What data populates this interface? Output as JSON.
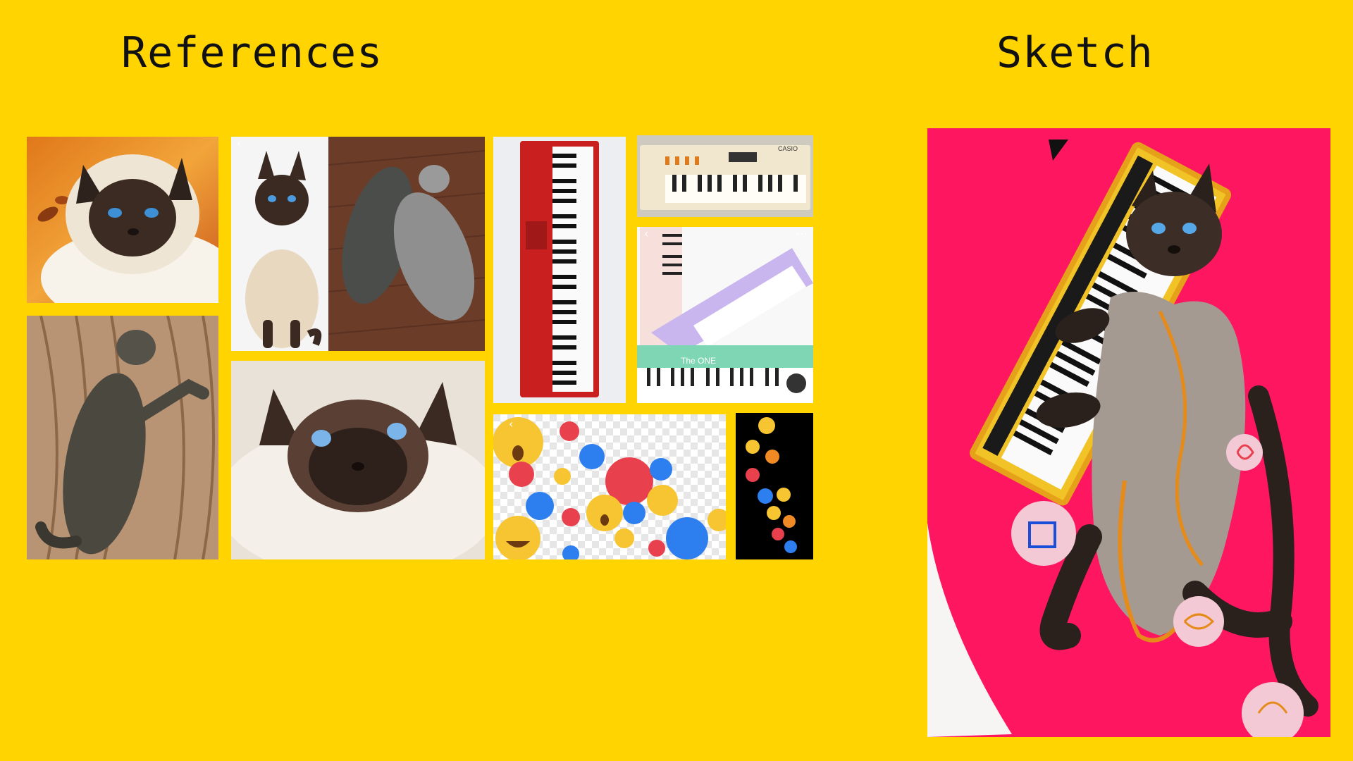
{
  "headings": {
    "references": "References",
    "sketch": "Sketch"
  },
  "colors": {
    "background": "#FFD400",
    "sketch_background": "#FF1660"
  },
  "reference_images": [
    {
      "subject": "Birman cat face, autumn leaves"
    },
    {
      "subject": "Siamese cat sitting"
    },
    {
      "subject": "Two grey cats lying on wooden floor"
    },
    {
      "subject": "Tabby cat lying on wooden floor"
    },
    {
      "subject": "Himalayan cat close-up"
    },
    {
      "subject": "Red keyboard piano"
    },
    {
      "subject": "Vintage Casio keyboard"
    },
    {
      "subject": "Purple and teal keyboards"
    },
    {
      "subject": "Facebook reaction emojis"
    },
    {
      "subject": "Facebook reaction emojis on black"
    }
  ],
  "casio_logo": "CASIO",
  "keyboard_brand": "The ONE",
  "sketch": {
    "subject": "Siamese cat playing keyboard"
  }
}
